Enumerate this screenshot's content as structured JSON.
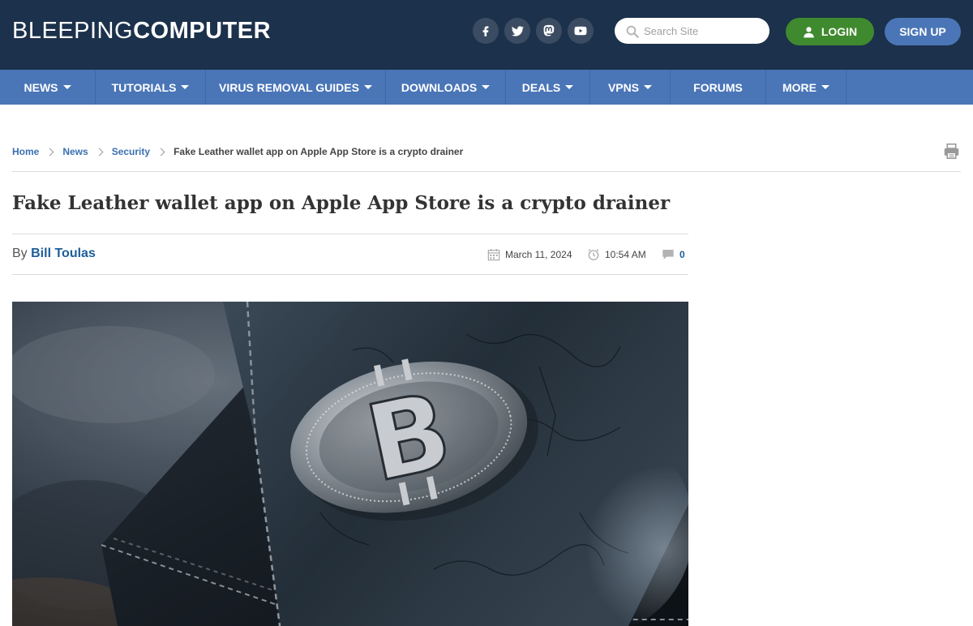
{
  "header": {
    "logo_light": "BLEEPING",
    "logo_bold": "COMPUTER",
    "social": [
      "facebook-icon",
      "twitter-icon",
      "mastodon-icon",
      "youtube-icon"
    ],
    "search_placeholder": "Search Site",
    "login_label": "LOGIN",
    "signup_label": "SIGN UP",
    "colors": {
      "header_bg": "#1c314b",
      "nav_bg": "#4a76b8",
      "login_bg": "#3f8a2e",
      "signup_bg": "#4a76b7"
    }
  },
  "nav": {
    "items": [
      {
        "label": "NEWS",
        "dropdown": true
      },
      {
        "label": "TUTORIALS",
        "dropdown": true
      },
      {
        "label": "VIRUS REMOVAL GUIDES",
        "dropdown": true
      },
      {
        "label": "DOWNLOADS",
        "dropdown": true
      },
      {
        "label": "DEALS",
        "dropdown": true
      },
      {
        "label": "VPNS",
        "dropdown": true
      },
      {
        "label": "FORUMS",
        "dropdown": false
      },
      {
        "label": "MORE",
        "dropdown": true
      }
    ]
  },
  "breadcrumb": {
    "items": [
      "Home",
      "News",
      "Security"
    ],
    "current": "Fake Leather wallet app on Apple App Store is a crypto drainer"
  },
  "article": {
    "title": "Fake Leather wallet app on Apple App Store is a crypto drainer",
    "by_label": "By",
    "author": "Bill Toulas",
    "date": "March 11, 2024",
    "time": "10:54 AM",
    "comments": "0"
  }
}
